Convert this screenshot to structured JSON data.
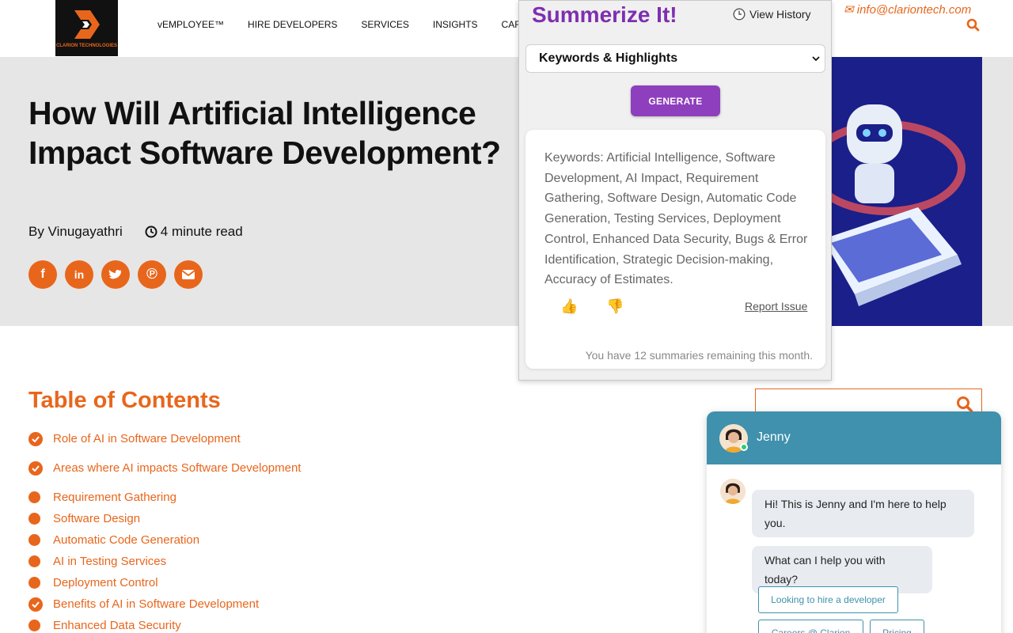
{
  "header": {
    "logo_text": "CLARION TECHNOLOGIES",
    "nav": [
      "vEMPLOYEE™",
      "HIRE DEVELOPERS",
      "SERVICES",
      "INSIGHTS",
      "CAREERS"
    ],
    "email": "info@clariontech.com"
  },
  "article": {
    "title": "How Will Artificial Intelligence Impact Software Development?",
    "author": "By Vinugayathri",
    "read_time": "4 minute read",
    "share_icons": [
      "facebook-icon",
      "linkedin-icon",
      "twitter-icon",
      "pinterest-icon",
      "email-icon"
    ]
  },
  "toc": {
    "title": "Table of Contents",
    "items": [
      {
        "label": "Role of AI in Software Development",
        "marker": "check"
      },
      {
        "label": "Areas where AI impacts Software Development",
        "marker": "check"
      },
      {
        "label": "Requirement Gathering",
        "marker": "dot"
      },
      {
        "label": "Software Design",
        "marker": "dot"
      },
      {
        "label": "Automatic Code Generation",
        "marker": "dot"
      },
      {
        "label": "AI in Testing Services",
        "marker": "dot"
      },
      {
        "label": "Deployment Control",
        "marker": "dot"
      },
      {
        "label": "Benefits of AI in Software Development",
        "marker": "check"
      },
      {
        "label": "Enhanced Data Security",
        "marker": "dot"
      }
    ]
  },
  "popup": {
    "title": "Summerize It!",
    "view_history": "View History",
    "mode_selected": "Keywords & Highlights",
    "generate_label": "GENERATE",
    "summary": "Keywords: Artificial Intelligence, Software Development, AI Impact, Requirement Gathering, Software Design, Automatic Code Generation, Testing Services, Deployment Control, Enhanced Data Security, Bugs & Error Identification, Strategic Decision-making, Accuracy of Estimates.",
    "report_label": "Report Issue",
    "remaining": "You have 12 summaries remaining this month.",
    "accent": "#8e3fbd"
  },
  "chat": {
    "agent_name": "Jenny",
    "messages": [
      "Hi! This is Jenny and I'm here to help you.",
      "What can I help you with today?"
    ],
    "quick_replies": [
      "Looking to hire a developer",
      "Careers @ Clarion",
      "Pricing"
    ],
    "header_color": "#3f91ad"
  },
  "colors": {
    "brand": "#e8661c",
    "hero_bg": "#e6e6e6"
  }
}
